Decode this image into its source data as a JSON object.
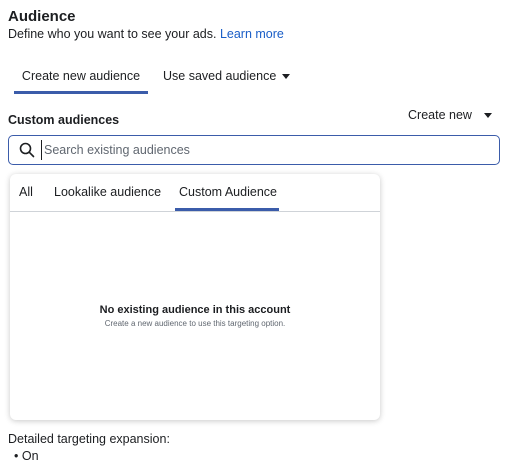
{
  "header": {
    "title": "Audience",
    "subtitle": "Define who you want to see your ads.",
    "learn_more": "Learn more"
  },
  "tabs": [
    {
      "label": "Create new audience"
    },
    {
      "label": "Use saved audience"
    }
  ],
  "custom_audiences": {
    "label": "Custom audiences",
    "create_new": "Create new",
    "search_placeholder": "Search existing audiences"
  },
  "dropdown": {
    "tabs": [
      {
        "label": "All"
      },
      {
        "label": "Lookalike audience"
      },
      {
        "label": "Custom Audience"
      }
    ],
    "empty_title": "No existing audience in this account",
    "empty_subtitle": "Create a new audience to use this targeting option."
  },
  "detailed_targeting": {
    "label": "Detailed targeting expansion:",
    "value": "On"
  },
  "colors": {
    "accent": "#3b5caa",
    "link": "#1a5ec7"
  },
  "icons": {
    "search": "search-icon",
    "caret": "caret-down-icon"
  }
}
